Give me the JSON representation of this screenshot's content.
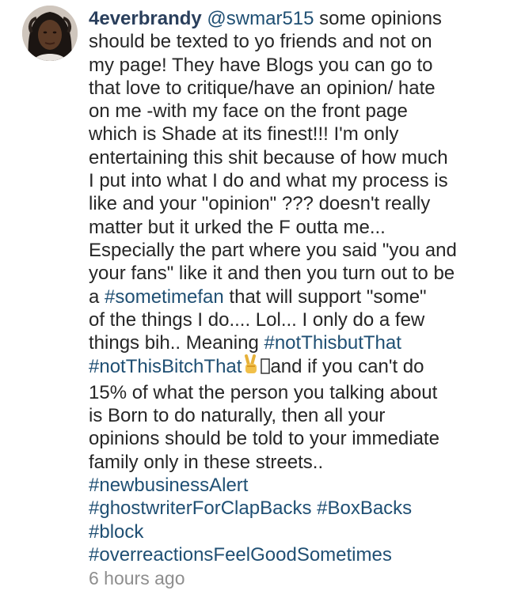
{
  "comment": {
    "username": "4everbrandy",
    "mention": "@swmar515",
    "lines": [
      "some opinions",
      "should be texted to yo friends and not on",
      "my page! They have Blogs you can go to",
      "that love to critique/have an opinion/ hate",
      "on me -with my face on the front page",
      "which is Shade at its finest!!! I'm only",
      "entertaining this shit because of how much",
      "I put into what I do and what my process is",
      "like and your \"opinion\" ??? doesn't really",
      "matter but it urked the F outta me...",
      "Especially the part where you said \"you and",
      "your fans\" like it and then you turn out to be",
      "a ",
      "#sometimefan",
      " that will support \"some\"",
      "of the things I do.... Lol... I only do a few",
      "things bih.. Meaning ",
      "#notThisbutThat",
      "#notThisBitchThat",
      "and if you can't do",
      "15% of what the person you talking about",
      "is Born to do naturally, then all your",
      "opinions should be told to your immediate",
      "family only in these streets..",
      "#newbusinessAlert",
      "#ghostwriterForClapBacks",
      "#BoxBacks",
      "#block",
      "#overreactionsFeelGoodSometimes"
    ],
    "timestamp": "6 hours ago"
  },
  "emoji": {
    "victory": "victory-hand-icon",
    "missing_glyph": "missing-glyph-icon"
  },
  "colors": {
    "text": "#262626",
    "username": "#2a3f5c",
    "link": "#1f4f73",
    "timestamp": "#8e8e8e",
    "background": "#ffffff"
  }
}
